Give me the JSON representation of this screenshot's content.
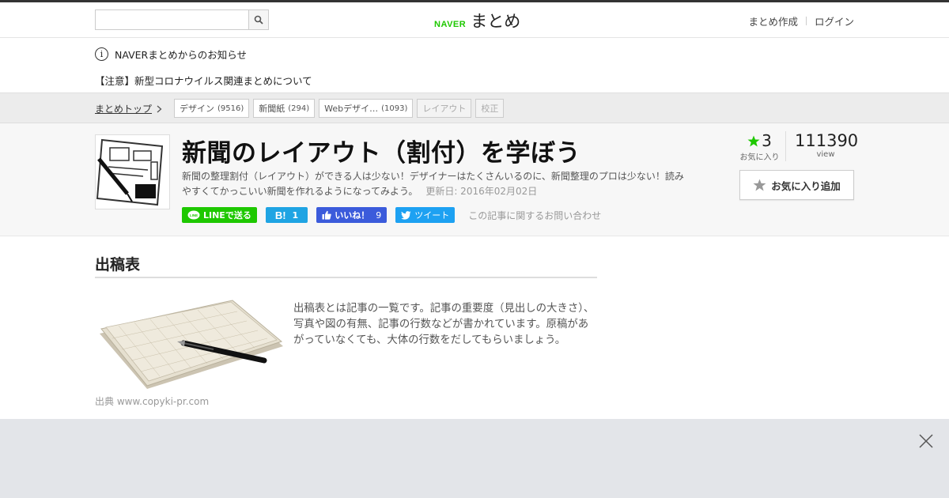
{
  "header": {
    "search_placeholder": "",
    "logo_brand": "NAVER",
    "logo_name": "まとめ",
    "links": [
      "まとめ作成",
      "ログイン"
    ]
  },
  "notice": {
    "title": "NAVERまとめからのお知らせ",
    "item": "【注意】新型コロナウイルス関連まとめについて"
  },
  "breadcrumb": {
    "top": "まとめトップ",
    "tags": [
      {
        "label": "デザイン",
        "count": "(9516)"
      },
      {
        "label": "新聞紙",
        "count": "(294)"
      },
      {
        "label": "Webデザイ…",
        "count": "(1093)"
      },
      {
        "label": "レイアウト",
        "count": ""
      },
      {
        "label": "校正",
        "count": ""
      }
    ]
  },
  "article": {
    "title": "新聞のレイアウト（割付）を学ぼう",
    "description": "新聞の整理割付（レイアウト）ができる人は少ない！デザイナーはたくさんいるのに、新聞整理のプロは少ない！読みやすくてかっこいい新聞を作れるようになってみよう。",
    "updated": "更新日: 2016年02月02日",
    "share": {
      "line": "LINEで送る",
      "hatena_count": "1",
      "facebook": "いいね！",
      "facebook_count": "9",
      "tweet": "ツイート",
      "contact": "この記事に関するお問い合わせ"
    },
    "favorites": "3",
    "favorites_label": "お気に入り",
    "views": "111390",
    "views_label": "view",
    "fav_button": "お気に入り追加"
  },
  "content": {
    "section_title": "出稿表",
    "paragraph": "出稿表とは記事の一覧です。記事の重要度（見出しの大きさ）、写真や図の有無、記事の行数などが書かれています。原稿があがっていなくても、大体の行数をだしてもらいましょう。",
    "source": "出典  www.copyki-pr.com"
  },
  "colors": {
    "accent_green": "#1ec800",
    "hatena_blue": "#1fa4e3",
    "facebook_blue": "#3b5bdb",
    "twitter_blue": "#1da1f2"
  }
}
